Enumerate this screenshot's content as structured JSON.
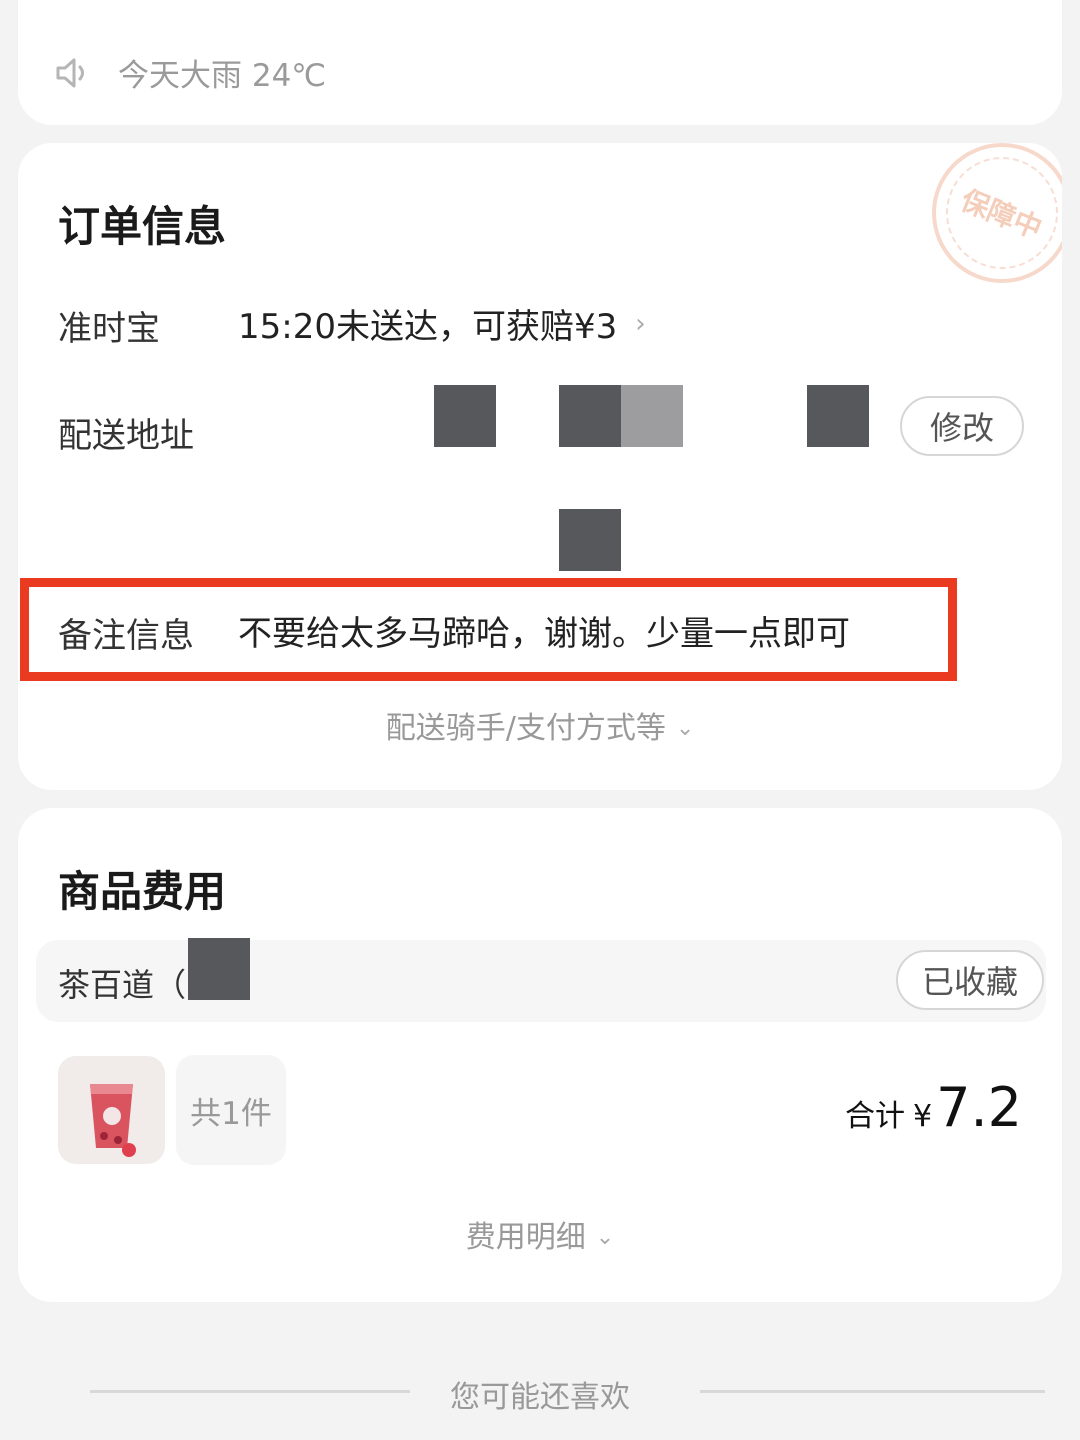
{
  "weather": {
    "icon": "speaker-icon",
    "text": "今天大雨 24℃"
  },
  "order_info": {
    "title": "订单信息",
    "stamp": "保障中",
    "ontime": {
      "label": "准时宝",
      "value": "15:20未送达，可获赔¥3"
    },
    "address": {
      "label": "配送地址",
      "edit_button": "修改"
    },
    "remark": {
      "label": "备注信息",
      "value": "不要给太多马蹄哈，谢谢。少量一点即可"
    },
    "more": "配送骑手/支付方式等"
  },
  "goods": {
    "title": "商品费用",
    "shop_name": "茶百道（",
    "favorite_button": "已收藏",
    "count": "共1件",
    "total_label": "合计",
    "currency": "¥",
    "total_amount": "7.2",
    "fee_detail": "费用明细"
  },
  "recommend": {
    "title": "您可能还喜欢"
  },
  "colors": {
    "highlight": "#ea3a20",
    "muted_text": "#999999",
    "card_bg": "#ffffff",
    "page_bg": "#f3f3f3"
  }
}
